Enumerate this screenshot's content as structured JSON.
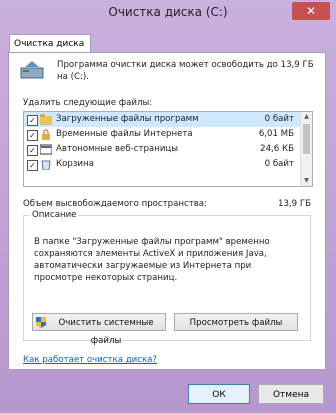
{
  "window": {
    "title": "Очистка диска  (C:)",
    "close_symbol": "✕"
  },
  "tab": {
    "label": "Очистка диска"
  },
  "summary": {
    "text": "Программа очистки диска может освободить до 13,9 ГБ на  (C:)."
  },
  "files": {
    "label": "Удалить следующие файлы:",
    "items": [
      {
        "name": "Загруженные файлы программ",
        "size": "0 байт",
        "checked": true,
        "selected": true
      },
      {
        "name": "Временные файлы Интернета",
        "size": "6,01 МБ",
        "checked": true,
        "selected": false
      },
      {
        "name": "Автономные веб-страницы",
        "size": "24,6 КБ",
        "checked": true,
        "selected": false
      },
      {
        "name": "Корзина",
        "size": "0 байт",
        "checked": true,
        "selected": false
      }
    ]
  },
  "total": {
    "label": "Объем высвобождаемого пространства:",
    "value": "13,9 ГБ"
  },
  "description": {
    "title": "Описание",
    "text": "В папке \"Загруженные файлы программ\" временно сохраняются элементы ActiveX и приложения Java, автоматически загружаемые из Интернета при просмотре некоторых страниц."
  },
  "buttons": {
    "clean_system": "Очистить системные файлы",
    "view_files": "Просмотреть файлы",
    "ok": "ОК",
    "cancel": "Отмена"
  },
  "help_link": "Как работает очистка диска?",
  "colors": {
    "accent": "#b698cf",
    "selection": "#cde8ff",
    "link": "#0066cc"
  }
}
